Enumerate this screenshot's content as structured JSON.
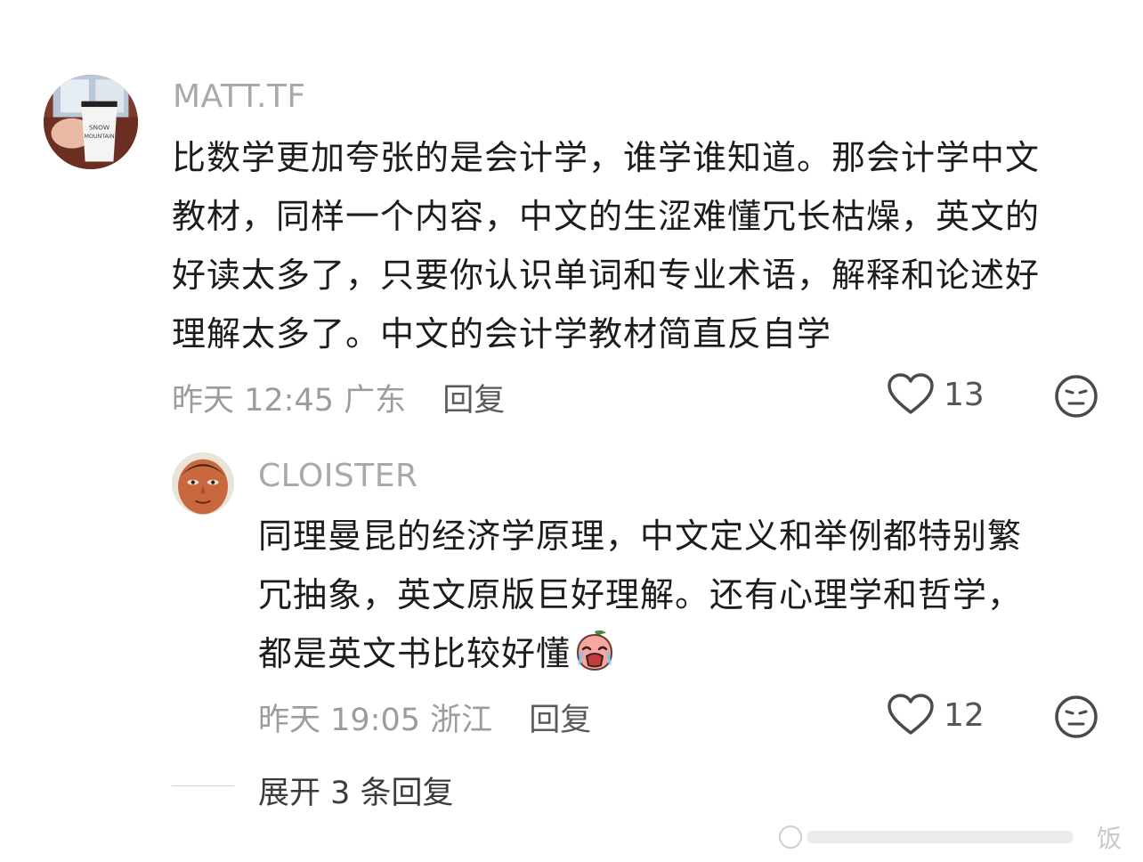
{
  "comments": [
    {
      "username": "MATT.TF",
      "lines": [
        "比数学更加夸张的是会计学，谁学谁知道。那会计学中文",
        "教材，同样一个内容，中文的生涩难懂冗长枯燥，英文的",
        "好读太多了，只要你认识单词和专业术语，解释和论述好",
        "理解太多了。中文的会计学教材简直反自学"
      ],
      "time": "昨天 12:45",
      "location": "广东",
      "reply_label": "回复",
      "likes": "13",
      "avatar_icon": "cup-photo-avatar"
    },
    {
      "username": "CLOISTER",
      "lines": [
        "同理曼昆的经济学原理，中文定义和举例都特别繁",
        "冗抽象，英文原版巨好理解。还有心理学和哲学，",
        "都是英文书比较好懂"
      ],
      "emoji": "crying-peach-emoji",
      "time": "昨天 19:05",
      "location": "浙江",
      "reply_label": "回复",
      "likes": "12",
      "avatar_icon": "painted-face-avatar"
    }
  ],
  "expand": {
    "label": "展开 3 条回复"
  },
  "watermark": {
    "text": "饭"
  },
  "colors": {
    "username": "#a9a9a9",
    "text": "#1c1c1c",
    "meta": "#9c9c9c",
    "icon_stroke": "#4a4a4a"
  }
}
